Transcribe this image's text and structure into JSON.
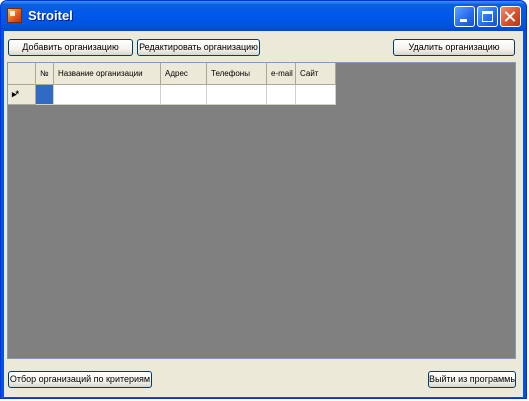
{
  "window": {
    "title": "Stroitel"
  },
  "toolbar": {
    "add_label": "Добавить организацию",
    "edit_label": "Редактировать организацию",
    "delete_label": "Удалить организацию"
  },
  "grid": {
    "columns": [
      "№",
      "Название организации",
      "Адрес",
      "Телефоны",
      "e-mail",
      "Сайт"
    ],
    "new_row_marker": "▸*",
    "rows": [
      [
        "",
        "",
        "",
        "",
        "",
        ""
      ]
    ]
  },
  "footer": {
    "filter_label": "Отбор организаций по критериям",
    "exit_label": "Выйти из программы"
  },
  "colors": {
    "titlebar": "#0054e3",
    "form_background": "#ece9d8",
    "grid_background": "#808080",
    "selected_cell": "#316ac5"
  }
}
